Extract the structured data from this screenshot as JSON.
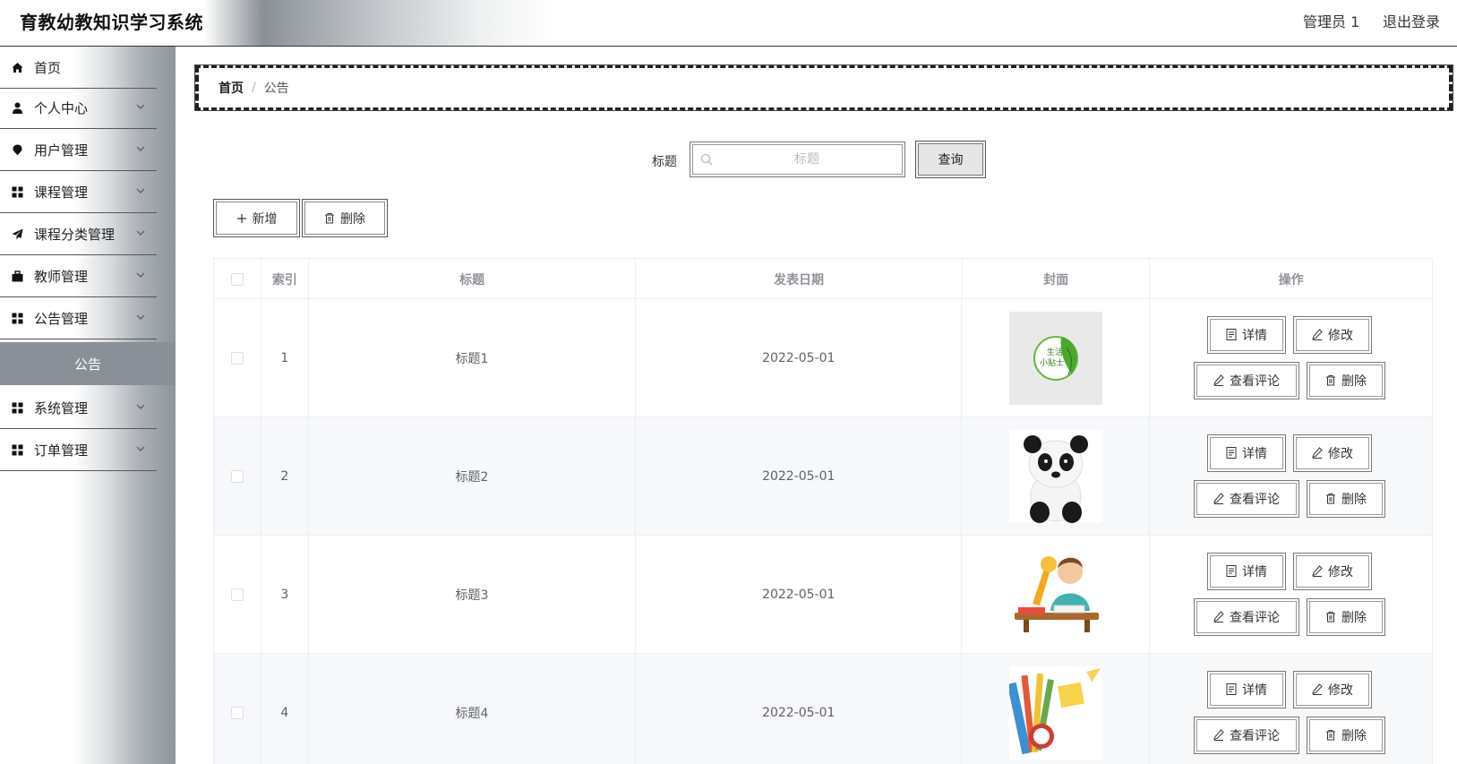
{
  "header": {
    "title": "育教幼教知识学习系统",
    "user_label": "管理员 1",
    "logout_label": "退出登录"
  },
  "sidebar": {
    "items": [
      {
        "label": "首页",
        "icon": "home-icon",
        "expandable": false
      },
      {
        "label": "个人中心",
        "icon": "user-icon",
        "expandable": true
      },
      {
        "label": "用户管理",
        "icon": "pin-icon",
        "expandable": true
      },
      {
        "label": "课程管理",
        "icon": "grid-icon",
        "expandable": true
      },
      {
        "label": "课程分类管理",
        "icon": "send-icon",
        "expandable": true
      },
      {
        "label": "教师管理",
        "icon": "briefcase-icon",
        "expandable": true
      },
      {
        "label": "公告管理",
        "icon": "grid-icon",
        "expandable": true
      },
      {
        "label": "系统管理",
        "icon": "grid-icon",
        "expandable": true
      },
      {
        "label": "订单管理",
        "icon": "grid-icon",
        "expandable": true
      }
    ],
    "active_sub": "公告",
    "active_bg": "#8a9097"
  },
  "breadcrumb": {
    "home": "首页",
    "separator": "/",
    "current": "公告"
  },
  "search": {
    "label": "标题",
    "placeholder": "标题",
    "button": "查询"
  },
  "actions": {
    "add": "新增",
    "delete": "删除"
  },
  "table": {
    "columns": [
      "索引",
      "标题",
      "发表日期",
      "封面",
      "操作"
    ],
    "rows": [
      {
        "index": "1",
        "title": "标题1",
        "date": "2022-05-01",
        "cover": "life-tips-image"
      },
      {
        "index": "2",
        "title": "标题2",
        "date": "2022-05-01",
        "cover": "panda-image"
      },
      {
        "index": "3",
        "title": "标题3",
        "date": "2022-05-01",
        "cover": "boy-studying-image"
      },
      {
        "index": "4",
        "title": "标题4",
        "date": "2022-05-01",
        "cover": "stationery-image"
      }
    ],
    "ops": {
      "detail": "详情",
      "edit": "修改",
      "comments": "查看评论",
      "delete": "删除"
    }
  }
}
